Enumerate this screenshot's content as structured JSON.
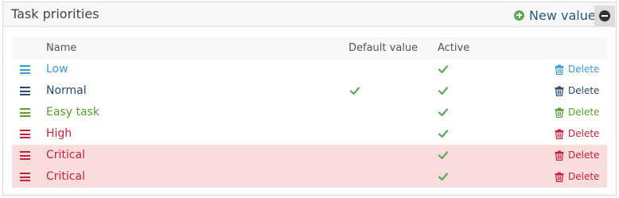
{
  "panel": {
    "title": "Task priorities",
    "new_value_label": "New value"
  },
  "columns": {
    "name": "Name",
    "default_value": "Default value",
    "active": "Active"
  },
  "rows": [
    {
      "name": "Low",
      "color": "#3a9bd5",
      "is_default": false,
      "active": true,
      "delete_label": "Delete",
      "highlight": false
    },
    {
      "name": "Normal",
      "color": "#2c4a6b",
      "is_default": true,
      "active": true,
      "delete_label": "Delete",
      "highlight": false
    },
    {
      "name": "Easy task",
      "color": "#5c9d2e",
      "is_default": false,
      "active": true,
      "delete_label": "Delete",
      "highlight": false
    },
    {
      "name": "High",
      "color": "#c8233c",
      "is_default": false,
      "active": true,
      "delete_label": "Delete",
      "highlight": false
    },
    {
      "name": "Critical",
      "color": "#c8233c",
      "is_default": false,
      "active": true,
      "delete_label": "Delete",
      "highlight": true
    },
    {
      "name": "Critical",
      "color": "#c8233c",
      "is_default": false,
      "active": true,
      "delete_label": "Delete",
      "highlight": true
    }
  ],
  "colors": {
    "check": "#5aaa5a",
    "link": "#2a5885",
    "alert_row": "#f9dcdc"
  },
  "icons": {
    "drag_handle": "hamburger-icon",
    "check": "check-icon",
    "delete": "trash-icon",
    "add": "plus-circle-icon",
    "collapse": "minus-circle-icon"
  }
}
